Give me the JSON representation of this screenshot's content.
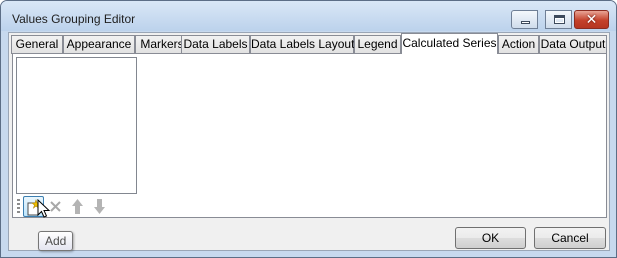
{
  "window": {
    "title": "Values Grouping Editor"
  },
  "caption_buttons": {
    "close_glyph": "✕"
  },
  "tabs": [
    {
      "label": "General",
      "active": false
    },
    {
      "label": "Appearance",
      "active": false
    },
    {
      "label": "Markers",
      "active": false
    },
    {
      "label": "Data Labels",
      "active": false
    },
    {
      "label": "Data Labels Layout",
      "active": false
    },
    {
      "label": "Legend",
      "active": false
    },
    {
      "label": "Calculated Series",
      "active": true
    },
    {
      "label": "Action",
      "active": false
    },
    {
      "label": "Data Output",
      "active": false
    }
  ],
  "calculated_series": {
    "items": [],
    "toolbar": {
      "add_icon": "add-series-icon",
      "remove_icon": "remove-x-icon",
      "move_up_icon": "arrow-up-icon",
      "move_down_icon": "arrow-down-icon"
    }
  },
  "tooltip": {
    "text": "Add"
  },
  "footer": {
    "ok_label": "OK",
    "cancel_label": "Cancel"
  }
}
